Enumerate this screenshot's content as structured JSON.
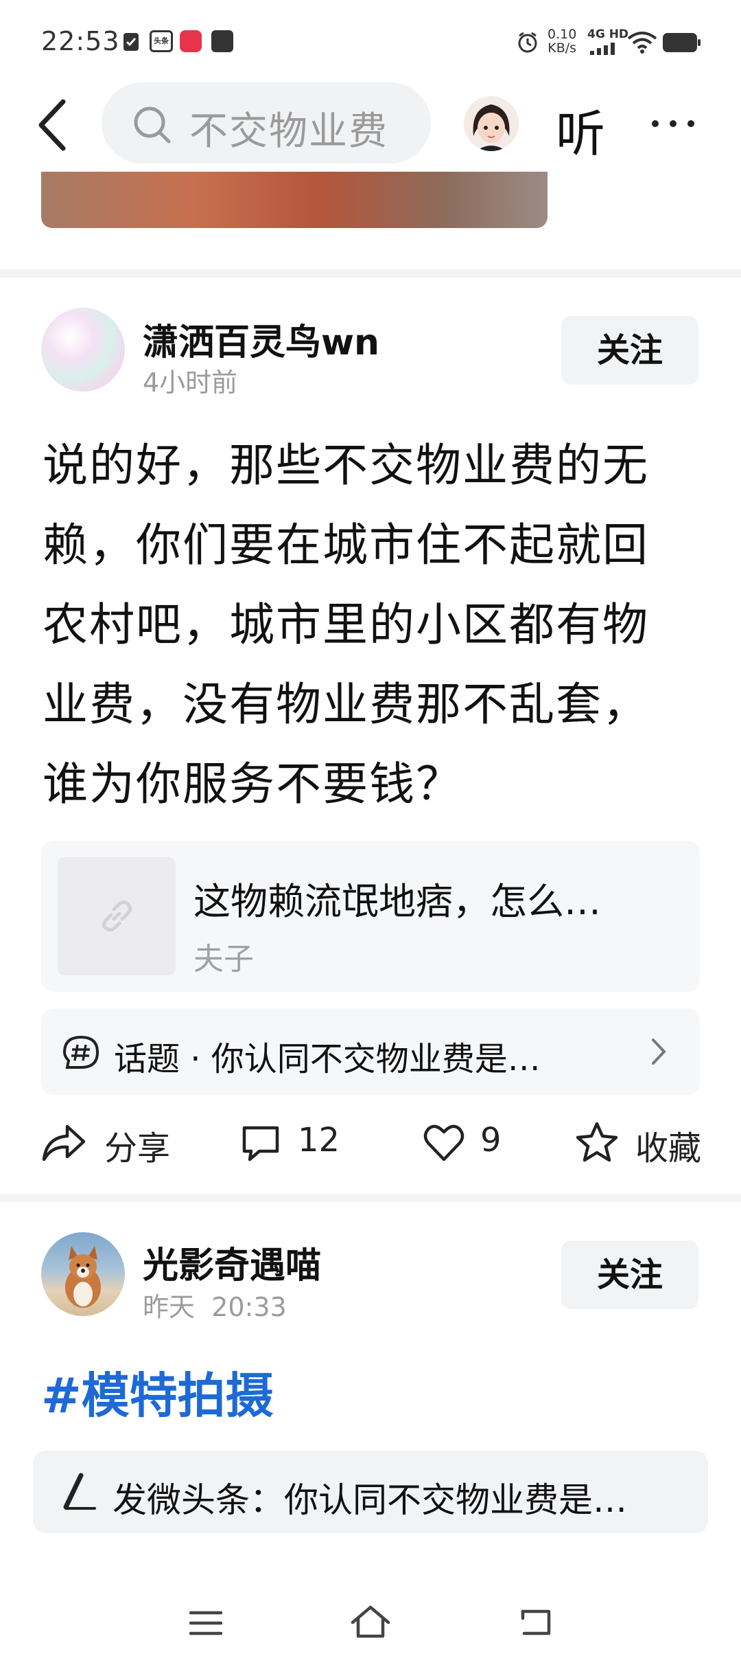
{
  "status_bar": {
    "time": "22:53",
    "net_speed_value": "0.10",
    "net_speed_unit": "KB/s",
    "network_label": "4G HD",
    "mini_app_label": "头条"
  },
  "nav": {
    "search_placeholder": "不交物业费",
    "listen_label": "听"
  },
  "post1": {
    "author": "潇洒百灵鸟wn",
    "time": "4小时前",
    "follow_label": "关注",
    "lines": [
      "说的好，那些不交物业费的无",
      "赖，你们要在城市住不起就回",
      "农村吧，城市里的小区都有物",
      "业费，没有物业费那不乱套，",
      "谁为你服务不要钱？"
    ],
    "quote": {
      "title": "这物赖流氓地痞，怎么…",
      "author": "夫子"
    },
    "topic": "话题 · 你认同不交物业费是…",
    "actions": {
      "share": "分享",
      "comments": "12",
      "likes": "9",
      "favorite": "收藏"
    }
  },
  "post2": {
    "author": "光影奇遇喵",
    "date": "昨天",
    "time": "20:33",
    "follow_label": "关注",
    "hashtag": "#模特拍摄"
  },
  "compose": {
    "text": "发微头条：你认同不交物业费是…"
  }
}
